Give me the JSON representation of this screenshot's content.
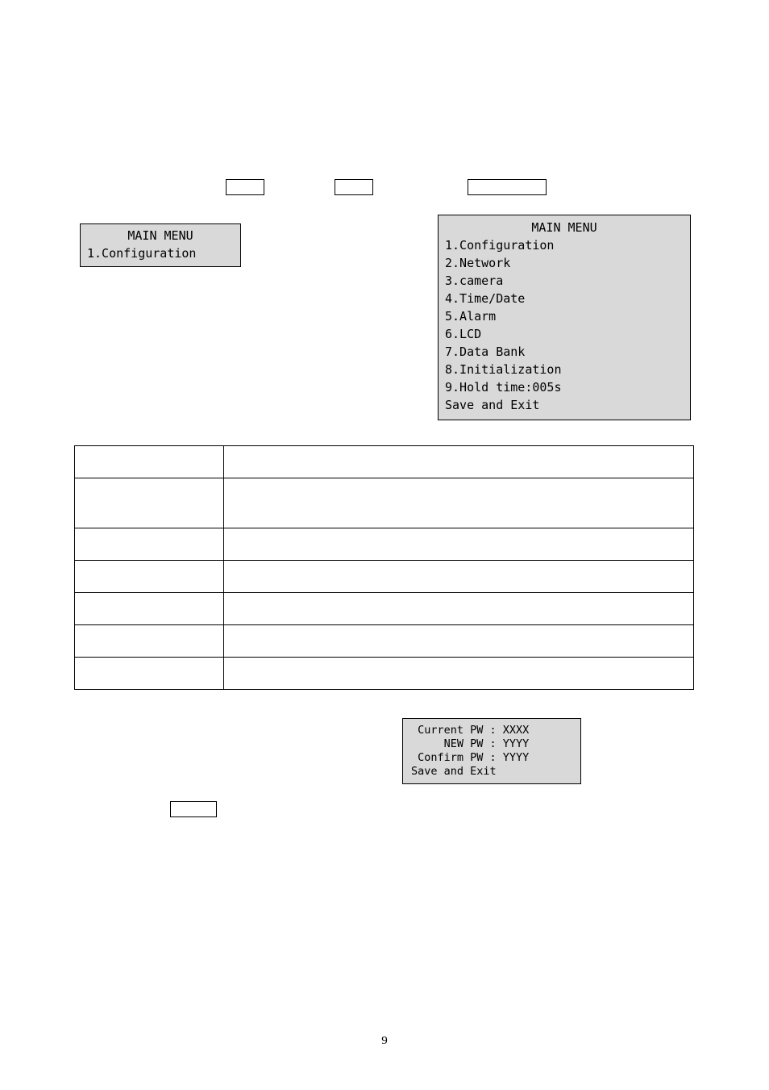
{
  "row_boxes": {
    "a": "",
    "b": "",
    "c": ""
  },
  "left_panel": {
    "title": "MAIN MENU",
    "line1": "1.Configuration"
  },
  "right_panel": {
    "title": "MAIN MENU",
    "items": [
      "1.Configuration",
      "2.Network",
      "3.camera",
      "4.Time/Date",
      "5.Alarm",
      "6.LCD",
      "7.Data Bank",
      "8.Initialization",
      "9.Hold time:005s",
      "Save and Exit"
    ]
  },
  "big_table": {
    "rows": 7,
    "cols": 2
  },
  "pw_panel": {
    "l1": " Current PW : XXXX",
    "l2": "     NEW PW : YYYY",
    "l3": " Confirm PW : YYYY",
    "l4": "Save and Exit"
  },
  "lone_box": "",
  "page_number": "9"
}
